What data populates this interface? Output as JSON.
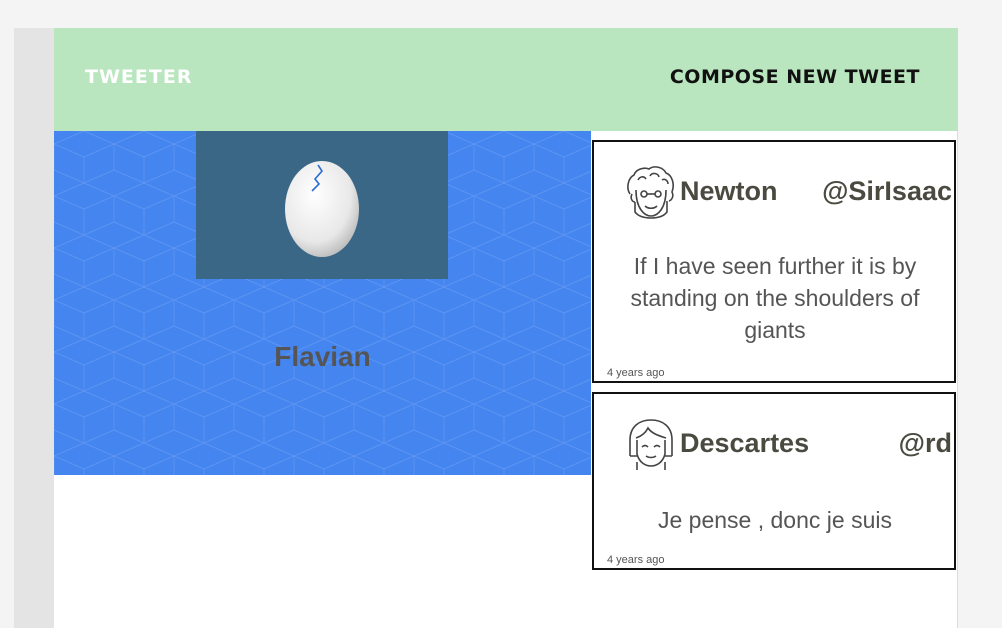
{
  "header": {
    "brand": "TWEETER",
    "compose_label": "COMPOSE NEW TWEET"
  },
  "profile": {
    "name": "Flavian",
    "avatar_icon": "egg-icon"
  },
  "tweets": [
    {
      "author": "Newton",
      "handle": "@SirIsaac",
      "text": "If I have seen further it is by standing on the shoulders of giants",
      "time": "4 years ago",
      "avatar_icon": "curly-hair-avatar-icon"
    },
    {
      "author": "Descartes",
      "handle": "@rd",
      "text": "Je pense , donc je suis",
      "time": "4 years ago",
      "avatar_icon": "bob-hair-avatar-icon"
    }
  ],
  "colors": {
    "header_bg": "#b9e6be",
    "profile_bg": "#4585ef",
    "avatar_box_bg": "#3b6787",
    "text_dark": "#4a4a40"
  }
}
